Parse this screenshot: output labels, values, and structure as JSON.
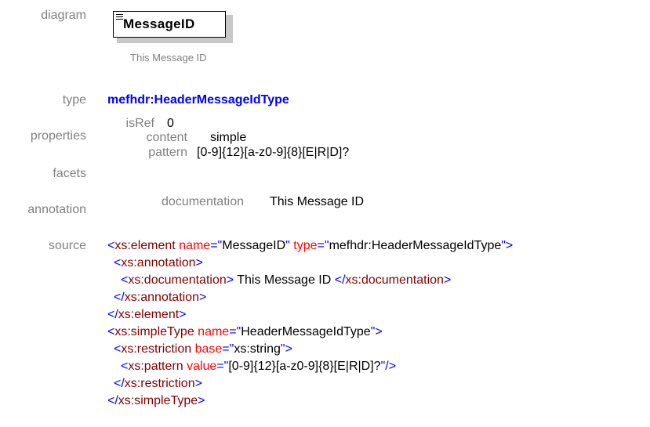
{
  "labels": {
    "diagram": "diagram",
    "type": "type",
    "properties": "properties",
    "facets": "facets",
    "annotation": "annotation",
    "source": "source"
  },
  "diagram": {
    "element_name": "MessageID",
    "caption": "This Message ID",
    "icon": "element-doc-icon"
  },
  "type": {
    "value": "mefhdr:HeaderMessageIdType"
  },
  "properties": {
    "isref_key": "isRef",
    "isref_val": "0",
    "content_key": "content",
    "content_val": "simple"
  },
  "facets": {
    "pattern_key": "pattern",
    "pattern_val": "[0-9]{12}[a-z0-9]{8}[E|R|D]?"
  },
  "annotation": {
    "doc_key": "documentation",
    "doc_val": "This Message ID"
  },
  "source": {
    "l1_open": "<",
    "l1_tag": "xs:element",
    "l1_attr1": "name",
    "l1_eq1": "=\"",
    "l1_val1": "MessageID",
    "l1_q1": "\"",
    "l1_attr2": "type",
    "l1_eq2": "=\"",
    "l1_val2": "mefhdr:HeaderMessageIdType",
    "l1_close": "\">",
    "l2_open": "<",
    "l2_tag": "xs:annotation",
    "l2_close": ">",
    "l3_open": "<",
    "l3_tag": "xs:documentation",
    "l3_close": ">",
    "l3_text": " This Message ID ",
    "l3_endopen": "</",
    "l3_endtag": "xs:documentation",
    "l3_endclose": ">",
    "l4_open": "</",
    "l4_tag": "xs:annotation",
    "l4_close": ">",
    "l5_open": "</",
    "l5_tag": "xs:element",
    "l5_close": ">",
    "l6_open": "<",
    "l6_tag": "xs:simpleType",
    "l6_attr": "name",
    "l6_eq": "=\"",
    "l6_val": "HeaderMessageIdType",
    "l6_close": "\">",
    "l7_open": "<",
    "l7_tag": "xs:restriction",
    "l7_attr": "base",
    "l7_eq": "=\"",
    "l7_val": "xs:string",
    "l7_close": "\">",
    "l8_open": "<",
    "l8_tag": "xs:pattern",
    "l8_attr": "value",
    "l8_eq": "=\"",
    "l8_val": "[0-9]{12}[a-z0-9]{8}[E|R|D]?",
    "l8_close": "\"/>",
    "l9_open": "</",
    "l9_tag": "xs:restriction",
    "l9_close": ">",
    "l10_open": "</",
    "l10_tag": "xs:simpleType",
    "l10_close": ">"
  }
}
